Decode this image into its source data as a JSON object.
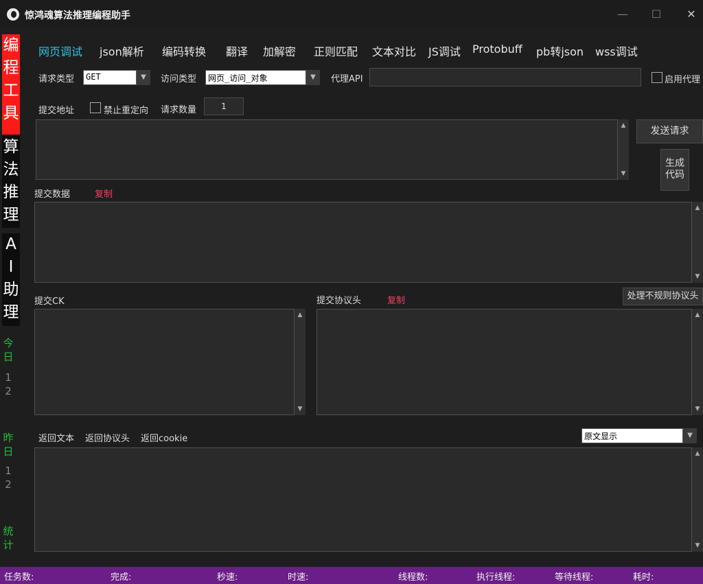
{
  "window": {
    "title": "惊鸿魂算法推理编程助手",
    "minimize": "—",
    "maximize": "☐",
    "close": "✕"
  },
  "sidebar": {
    "tools": [
      "编",
      "程",
      "工",
      "具"
    ],
    "algo": [
      "算",
      "法",
      "推",
      "理"
    ],
    "ai": [
      "A",
      "I",
      "助",
      "理"
    ],
    "today_label": [
      "今",
      "日"
    ],
    "today_values": [
      "1",
      "2"
    ],
    "yesterday_label": [
      "昨",
      "日"
    ],
    "yesterday_values": [
      "1",
      "2"
    ],
    "stats_label": [
      "统",
      "计"
    ]
  },
  "tabs": [
    "网页调试",
    "json解析",
    "编码转换",
    "翻译",
    "加解密",
    "正则匹配",
    "文本对比",
    "JS调试",
    "Protobuff",
    "pb转json",
    "wss调试"
  ],
  "request": {
    "type_label": "请求类型",
    "type_value": "GET",
    "access_label": "访问类型",
    "access_value": "网页_访问_对象",
    "proxy_label": "代理API",
    "proxy_value": "",
    "enable_proxy_label": "启用代理",
    "submit_url_label": "提交地址",
    "no_redirect_label": "禁止重定向",
    "count_label": "请求数量",
    "count_value": "1",
    "send_button": "发送请求",
    "gen_code_button": [
      "生成",
      "代码"
    ]
  },
  "sections": {
    "post_data_label": "提交数据",
    "copy_label": "复制",
    "ck_label": "提交CK",
    "headers_label": "提交协议头",
    "headers_copy_label": "复制",
    "irregular_headers_button": "处理不规则协议头",
    "return_text_tab": "返回文本",
    "return_headers_tab": "返回协议头",
    "return_cookie_tab": "返回cookie",
    "display_mode": "原文显示"
  },
  "status": {
    "tasks": "任务数:",
    "done": "完成:",
    "speed": "秒速:",
    "time_speed": "时速:",
    "threads": "线程数:",
    "running_threads": "执行线程:",
    "waiting_threads": "等待线程:",
    "elapsed": "耗时:"
  },
  "colors": {
    "accent_tab": "#2ec4e8",
    "tools_bg": "#ff1a1a",
    "copy_red": "#ee4060",
    "status_bar": "#6b1e87",
    "stat_green": "#22c03a"
  }
}
